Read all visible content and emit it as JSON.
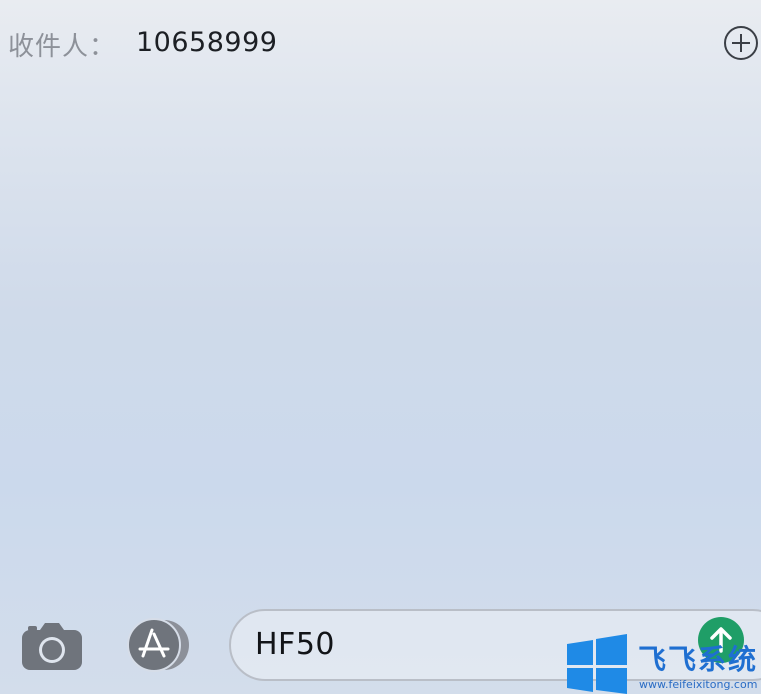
{
  "recipient": {
    "label": "收件人：",
    "value": "10658999"
  },
  "message": {
    "text": "HF50"
  },
  "icons": {
    "add": "plus-circle-icon",
    "camera": "camera-icon",
    "apps": "app-store-icon",
    "send": "arrow-up-icon"
  },
  "colors": {
    "send": "#1f9e67",
    "watermark": "#1f6fd1"
  },
  "watermark": {
    "title": "飞飞系统",
    "url": "www.feifeixitong.com"
  }
}
